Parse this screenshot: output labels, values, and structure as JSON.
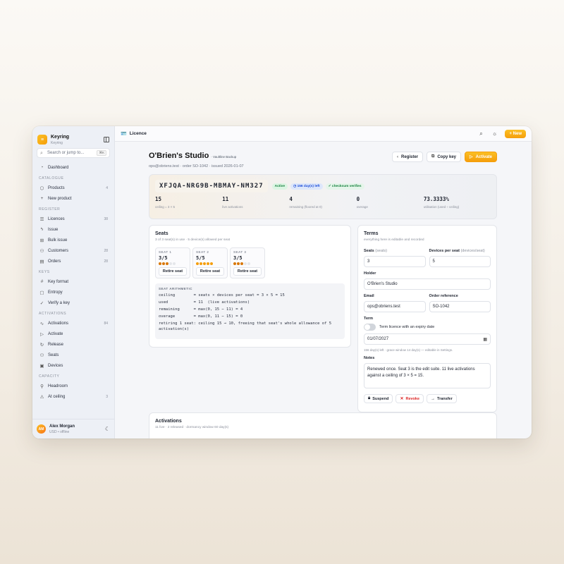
{
  "brand": {
    "title": "Keyring",
    "subtitle": "Keyring"
  },
  "search": {
    "placeholder": "Search or jump to...",
    "shortcut": "⌘K"
  },
  "sidebar": {
    "dashboard": "Dashboard",
    "sections": {
      "catalogue": "Catalogue",
      "register": "Register",
      "keys": "Keys",
      "activations": "Activations",
      "capacity": "Capacity"
    },
    "catalogue": [
      {
        "label": "Products",
        "count": "4",
        "icon": "cube-icon"
      },
      {
        "label": "New product",
        "count": "",
        "icon": "plus-icon"
      }
    ],
    "register": [
      {
        "label": "Licences",
        "count": "38",
        "icon": "list-icon"
      },
      {
        "label": "Issue",
        "count": "",
        "icon": "bolt-icon"
      },
      {
        "label": "Bulk issue",
        "count": "",
        "icon": "grid-icon"
      },
      {
        "label": "Customers",
        "count": "28",
        "icon": "users-icon"
      },
      {
        "label": "Orders",
        "count": "28",
        "icon": "receipt-icon"
      }
    ],
    "keys": [
      {
        "label": "Key format",
        "count": "",
        "icon": "hash-icon"
      },
      {
        "label": "Entropy",
        "count": "",
        "icon": "square-icon"
      },
      {
        "label": "Verify a key",
        "count": "",
        "icon": "check-icon"
      }
    ],
    "activations": [
      {
        "label": "Activations",
        "count": "84",
        "icon": "pulse-icon"
      },
      {
        "label": "Activate",
        "count": "",
        "icon": "play-icon"
      },
      {
        "label": "Release",
        "count": "",
        "icon": "refresh-icon"
      },
      {
        "label": "Seats",
        "count": "",
        "icon": "users-icon"
      },
      {
        "label": "Devices",
        "count": "",
        "icon": "device-icon"
      }
    ],
    "capacity": [
      {
        "label": "Headroom",
        "count": "",
        "icon": "gauge-icon"
      },
      {
        "label": "At ceiling",
        "count": "3",
        "icon": "warning-icon"
      }
    ]
  },
  "user": {
    "initials": "AM",
    "name": "Alex Morgan",
    "meta": "USD • offline"
  },
  "topbar": {
    "crumb": "Licence",
    "new_label": "New"
  },
  "licence": {
    "title": "O'Brien's Studio",
    "product_tag": "· Vaultline Backup",
    "subtitle": "ops@obriens.test · order SO-1042 · issued 2026-01-07",
    "register_label": "Register",
    "copy_label": "Copy key",
    "activate_label": "Activate",
    "key": "XFJQA-NRG9B-MBMAY-NM327",
    "badges": {
      "status": "Active",
      "days_left": "156 day(s) left",
      "checksum": "checksum verifies"
    },
    "stats": [
      {
        "value": "15",
        "label": "ceiling = 3 × 5"
      },
      {
        "value": "11",
        "label": "live activations"
      },
      {
        "value": "4",
        "label": "remaining (floored at 0)"
      },
      {
        "value": "0",
        "label": "overage"
      },
      {
        "value": "73.3333%",
        "label": "utilisation (used ÷ ceiling)"
      }
    ]
  },
  "seats": {
    "title": "Seats",
    "subtitle": "3 of 3 seat(s) in use · 5 device(s) allowed per seat",
    "items": [
      {
        "label": "SEAT 1",
        "value": "3/5",
        "filled": 3,
        "button": "Retire seat"
      },
      {
        "label": "SEAT 2",
        "value": "5/5",
        "filled": 5,
        "button": "Retire seat"
      },
      {
        "label": "SEAT 3",
        "value": "3/5",
        "filled": 3,
        "button": "Retire seat"
      }
    ],
    "arith_title": "SEAT ARITHMETIC",
    "arith_lines": [
      "ceiling        = seats × devices per seat = 3 × 5 = 15",
      "used           = 11  (live activations)",
      "remaining      = max(0, 15 − 11) = 4",
      "overage        = max(0, 11 − 15) = 0",
      "retiring 1 seat: ceiling 15 → 10, freeing that seat's whole allowance of 5",
      "activation(s)"
    ]
  },
  "terms": {
    "title": "Terms",
    "subtitle": "everything here is editable and recorded",
    "seats_label": "Seats",
    "seats_hint": "(seats)",
    "seats_value": "3",
    "devices_label": "Devices per seat",
    "devices_hint": "(devices/seat)",
    "devices_value": "5",
    "holder_label": "Holder",
    "holder_value": "O'Brien's Studio",
    "email_label": "Email",
    "email_value": "ops@obriens.test",
    "order_label": "Order reference",
    "order_value": "SO-1042",
    "term_label": "Term",
    "toggle_label": "Term licence with an expiry date",
    "date_value": "01/07/2027",
    "date_helper": "156 day(s) left · grace window 14 day(s) — editable in Settings.",
    "notes_label": "Notes",
    "notes_value": "Renewed once. Seat 3 is the edit suite. 11 live activations against a ceiling of 3 × 5 = 15.",
    "suspend_label": "Suspend",
    "revoke_label": "Revoke",
    "transfer_label": "Transfer"
  },
  "activations": {
    "title": "Activations",
    "subtitle": "11 live · 2 released · dormancy window 60 day(s)"
  }
}
